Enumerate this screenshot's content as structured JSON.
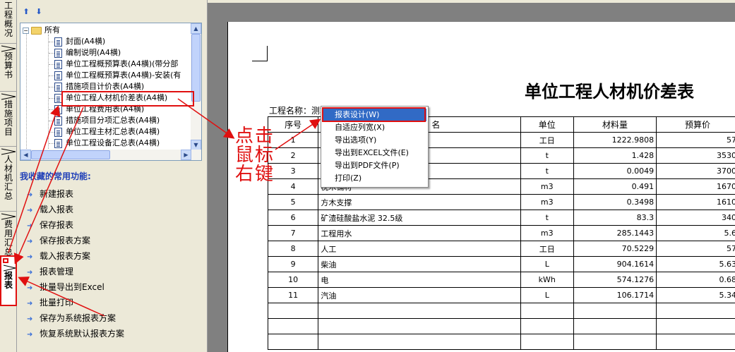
{
  "vertical_tabs": [
    {
      "label": "工程概况",
      "active": false
    },
    {
      "label": "预算书",
      "active": false
    },
    {
      "label": "措施项目",
      "active": false
    },
    {
      "label": "人材机汇总",
      "active": false
    },
    {
      "label": "费用汇总",
      "active": false
    },
    {
      "label": "报表",
      "active": true
    }
  ],
  "tree": {
    "toolbar": [
      "move-up-icon",
      "move-down-icon"
    ],
    "root": {
      "label": "所有"
    },
    "items": [
      {
        "label": "封面(A4横)"
      },
      {
        "label": "编制说明(A4横)"
      },
      {
        "label": "单位工程概预算表(A4横)(带分部"
      },
      {
        "label": "单位工程概预算表(A4横)-安装(有"
      },
      {
        "label": "措施项目计价表(A4横)"
      },
      {
        "label": "单位工程人材机价差表(A4横)",
        "selected": true
      },
      {
        "label": "单位工程费用表(A4横)"
      },
      {
        "label": "措施项目分项汇总表(A4横)"
      },
      {
        "label": "单位工程主材汇总表(A4横)"
      },
      {
        "label": "单位工程设备汇总表(A4横)"
      }
    ]
  },
  "favorites": {
    "title": "我收藏的常用功能:",
    "items": [
      {
        "label": "新建报表"
      },
      {
        "label": "载入报表"
      },
      {
        "label": "保存报表"
      },
      {
        "label": "保存报表方案"
      },
      {
        "label": "载入报表方案"
      },
      {
        "label": "报表管理"
      },
      {
        "label": "批量导出到Excel"
      },
      {
        "label": "批量打印"
      },
      {
        "label": "保存为系统报表方案"
      },
      {
        "label": "恢复系统默认报表方案"
      }
    ]
  },
  "report": {
    "title": "单位工程人材机价差表",
    "project_label": "工程名称：测算",
    "columns": [
      "序号",
      "名",
      "单位",
      "材料量",
      "预算价"
    ],
    "rows": [
      {
        "no": "1",
        "name": "",
        "unit": "工日",
        "qty": "1222.9808",
        "price": "57"
      },
      {
        "no": "2",
        "name": "",
        "unit": "t",
        "qty": "1.428",
        "price": "3530"
      },
      {
        "no": "3",
        "name": "",
        "unit": "t",
        "qty": "0.0049",
        "price": "3700"
      },
      {
        "no": "4",
        "name": "枕木铺材",
        "unit": "m3",
        "qty": "0.491",
        "price": "1670"
      },
      {
        "no": "5",
        "name": "方木支撑",
        "unit": "m3",
        "qty": "0.3498",
        "price": "1610"
      },
      {
        "no": "6",
        "name": "矿渣硅酸盐水泥 32.5级",
        "unit": "t",
        "qty": "83.3",
        "price": "340"
      },
      {
        "no": "7",
        "name": "工程用水",
        "unit": "m3",
        "qty": "285.1443",
        "price": "5.6"
      },
      {
        "no": "8",
        "name": "人工",
        "unit": "工日",
        "qty": "70.5229",
        "price": "57"
      },
      {
        "no": "9",
        "name": "柴油",
        "unit": "L",
        "qty": "904.1614",
        "price": "5.63"
      },
      {
        "no": "10",
        "name": "电",
        "unit": "kWh",
        "qty": "574.1276",
        "price": "0.68"
      },
      {
        "no": "11",
        "name": "汽油",
        "unit": "L",
        "qty": "106.1714",
        "price": "5.34"
      }
    ]
  },
  "context_menu": {
    "items": [
      {
        "label": "报表设计(W)",
        "highlighted": true
      },
      {
        "label": "自适应列宽(X)"
      },
      {
        "label": "导出选项(Y)"
      },
      {
        "label": "导出到EXCEL文件(E)"
      },
      {
        "label": "导出到PDF文件(P)"
      },
      {
        "label": "打印(Z)"
      }
    ]
  },
  "annotation": {
    "text": "点击鼠标右键",
    "color": "#e01010"
  },
  "colors": {
    "panel_bg": "#ece9d8",
    "preview_bg": "#808080",
    "menu_highlight": "#316ac5",
    "favorites_title": "#1f3fb8",
    "annotation": "#e01010"
  }
}
